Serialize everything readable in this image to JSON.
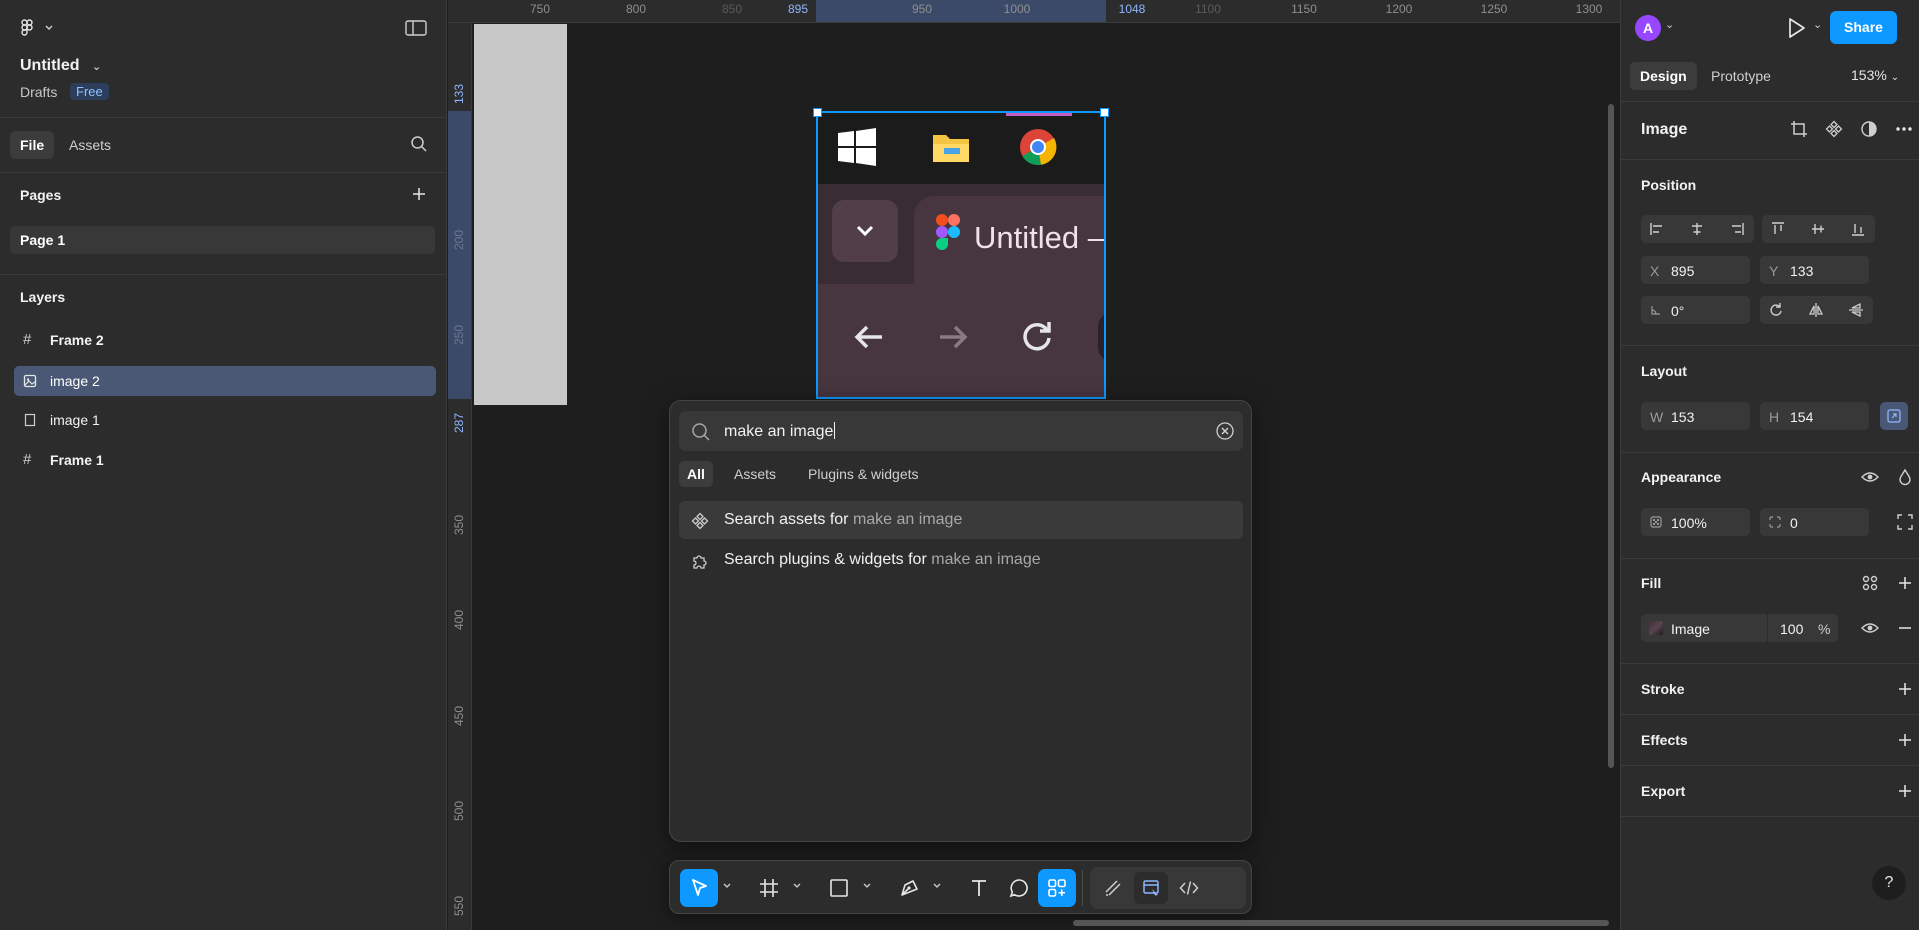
{
  "left_panel": {
    "file_title": "Untitled",
    "location": "Drafts",
    "plan_badge": "Free",
    "tabs": {
      "file": "File",
      "assets": "Assets"
    },
    "pages_label": "Pages",
    "pages": [
      "Page 1"
    ],
    "layers_label": "Layers",
    "layers": [
      {
        "name": "Frame 2",
        "icon": "frame-icon",
        "selected": false
      },
      {
        "name": "image 2",
        "icon": "image-icon",
        "selected": true
      },
      {
        "name": "image 1",
        "icon": "rectangle-icon",
        "selected": false
      },
      {
        "name": "Frame 1",
        "icon": "frame-icon",
        "selected": false
      }
    ]
  },
  "canvas": {
    "ruler_x": {
      "t750": "750",
      "t800": "800",
      "t850": "850",
      "t895": "895",
      "t950": "950",
      "t1000": "1000",
      "t1048": "1048",
      "t1100": "1100",
      "t1150": "1150",
      "t1200": "1200",
      "t1250": "1250",
      "t1300": "1300"
    },
    "ruler_y": {
      "t133": "133",
      "t200": "200",
      "t250": "250",
      "t287": "287",
      "t350": "350",
      "t400": "400",
      "t450": "450",
      "t500": "500",
      "t550": "550"
    },
    "image_content": {
      "tab_title": "Untitled –"
    }
  },
  "search_popup": {
    "query": "make an image",
    "filters": [
      "All",
      "Assets",
      "Plugins & widgets"
    ],
    "active_filter": "All",
    "results": [
      {
        "prefix": "Search assets for",
        "term": "make an image",
        "icon": "component-icon"
      },
      {
        "prefix": "Search plugins & widgets for",
        "term": "make an image",
        "icon": "plugin-icon"
      }
    ]
  },
  "toolbar": {
    "tools": [
      "move-tool",
      "frame-tool",
      "rectangle-tool",
      "pen-tool",
      "text-tool",
      "comment-tool",
      "actions-tool"
    ],
    "active": "move-tool",
    "modes": [
      "draw-mode",
      "design-mode",
      "dev-mode"
    ]
  },
  "right_panel": {
    "avatar_initial": "A",
    "share_label": "Share",
    "tabs": {
      "design": "Design",
      "prototype": "Prototype"
    },
    "zoom": "153%",
    "selection_title": "Image",
    "position": {
      "label": "Position",
      "x_label": "X",
      "x": "895",
      "y_label": "Y",
      "y": "133",
      "rotation": "0°"
    },
    "layout": {
      "label": "Layout",
      "w_label": "W",
      "w": "153",
      "h_label": "H",
      "h": "154"
    },
    "appearance": {
      "label": "Appearance",
      "opacity": "100%",
      "radius": "0"
    },
    "fill": {
      "label": "Fill",
      "type": "Image",
      "opacity": "100",
      "pct": "%"
    },
    "stroke_label": "Stroke",
    "effects_label": "Effects",
    "export_label": "Export",
    "help": "?"
  },
  "colors": {
    "accent": "#0d99ff",
    "selection_row": "#4a5876",
    "panel": "#2c2c2c",
    "canvas": "#1e1e1e",
    "avatar": "#9747ff"
  }
}
